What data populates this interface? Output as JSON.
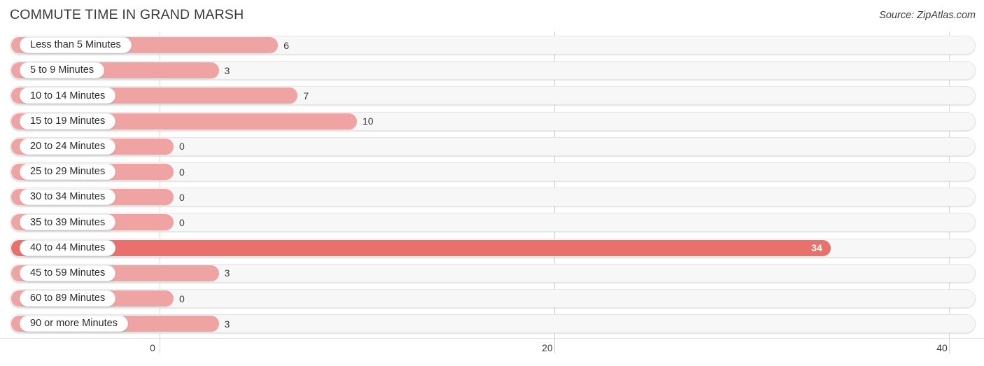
{
  "header": {
    "title": "COMMUTE TIME IN GRAND MARSH",
    "source": "Source: ZipAtlas.com"
  },
  "chart_data": {
    "type": "bar",
    "orientation": "horizontal",
    "title": "COMMUTE TIME IN GRAND MARSH",
    "xlabel": "",
    "ylabel": "",
    "xlim": [
      0,
      40
    ],
    "ticks": [
      {
        "label": "0",
        "value": 0
      },
      {
        "label": "20",
        "value": 20
      },
      {
        "label": "40",
        "value": 40
      }
    ],
    "grid": true,
    "legend": "none",
    "accent_color": "#f0a3a3",
    "highlight_color": "#e8716b",
    "track_color": "#f7f7f7",
    "categories": [
      "Less than 5 Minutes",
      "5 to 9 Minutes",
      "10 to 14 Minutes",
      "15 to 19 Minutes",
      "20 to 24 Minutes",
      "25 to 29 Minutes",
      "30 to 34 Minutes",
      "35 to 39 Minutes",
      "40 to 44 Minutes",
      "45 to 59 Minutes",
      "60 to 89 Minutes",
      "90 or more Minutes"
    ],
    "values": [
      6,
      3,
      7,
      10,
      0,
      0,
      0,
      0,
      34,
      3,
      0,
      3
    ],
    "value_labels": [
      "6",
      "3",
      "7",
      "10",
      "0",
      "0",
      "0",
      "0",
      "34",
      "3",
      "0",
      "3"
    ],
    "highlighted_index": 8
  }
}
